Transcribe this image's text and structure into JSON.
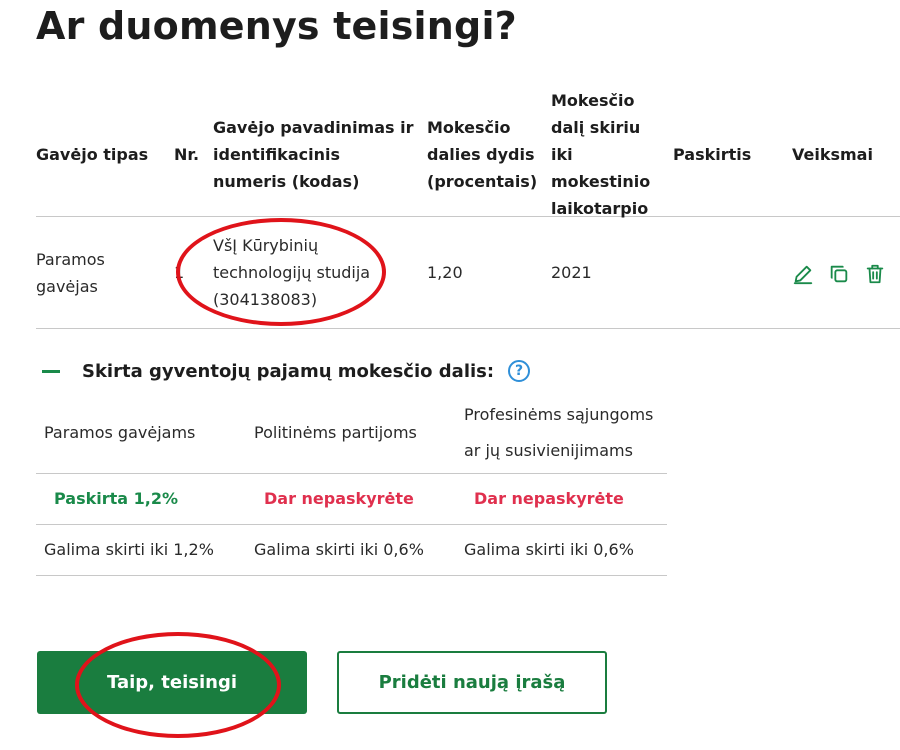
{
  "page_title": "Ar duomenys teisingi?",
  "table": {
    "headers": {
      "tipas": "Gavėjo tipas",
      "nr": "Nr.",
      "name": "Gavėjo pavadinimas ir identifikacinis numeris (kodas)",
      "dydis": "Mokesčio dalies dydis (procentais)",
      "laikotarpis": "Mokesčio dalį skiriu iki mokestinio laikotarpio",
      "paskirtis": "Paskirtis",
      "veiksmai": "Veiksmai"
    },
    "rows": [
      {
        "tipas": "Paramos gavėjas",
        "nr": "1",
        "name": "VšĮ Kūrybinių technologijų studija (304138083)",
        "dydis": "1,20",
        "laikotarpis": "2021",
        "paskirtis": "",
        "actions": [
          "edit-icon",
          "copy-icon",
          "delete-icon"
        ]
      }
    ]
  },
  "summary": {
    "title": "Skirta gyventojų pajamų mokesčio dalis:",
    "columns": [
      {
        "header": "Paramos gavėjams",
        "status": "Paskirta 1,2%",
        "limit": "Galima skirti iki 1,2%"
      },
      {
        "header": "Politinėms partijoms",
        "status": "Dar nepaskyrėte",
        "limit": "Galima skirti iki 0,6%"
      },
      {
        "header": "Profesinėms sąjungoms ar jų susivienijimams",
        "status": "Dar nepaskyrėte",
        "limit": "Galima skirti iki 0,6%"
      }
    ]
  },
  "buttons": {
    "confirm": "Taip, teisingi",
    "add_new": "Pridėti naują įrašą"
  },
  "colors": {
    "primary_green": "#1a7d3f",
    "status_green": "#1a8a4a",
    "status_red": "#e0304e",
    "help_blue": "#2f8fd8",
    "annotation_red": "#e0131a"
  }
}
